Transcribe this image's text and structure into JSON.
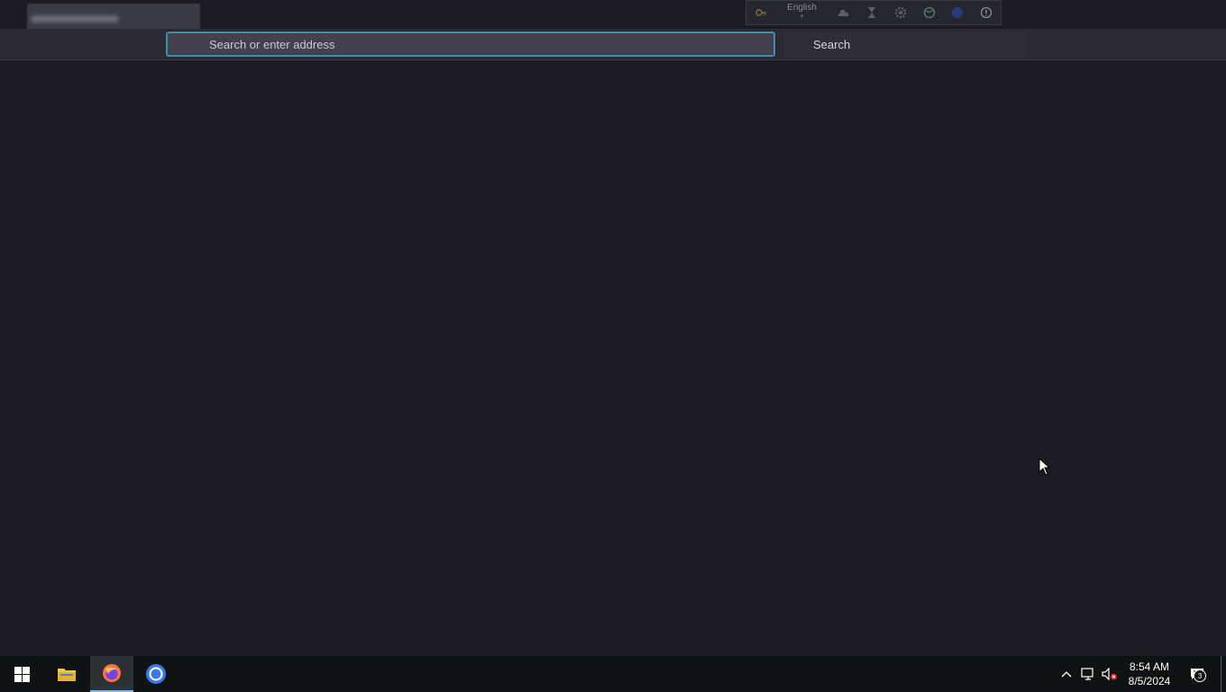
{
  "tab": {
    "title": ""
  },
  "floating_toolbar": {
    "language": "English",
    "icons": [
      "key-icon",
      "language-selector",
      "cloud-icon",
      "hourglass-icon",
      "gear-icon",
      "globe-icon",
      "help-icon",
      "info-icon"
    ]
  },
  "navbar": {
    "url_placeholder": "Search or enter address",
    "url_value": "",
    "search_button_label": "Search"
  },
  "taskbar": {
    "apps": [
      "start-button",
      "file-explorer",
      "firefox",
      "chrome"
    ],
    "active_app": "firefox",
    "tray_icons": [
      "chevron-up-icon",
      "network-icon",
      "volume-muted-icon"
    ],
    "time": "8:54 AM",
    "date": "8/5/2024",
    "notification_count": "3"
  },
  "colors": {
    "page_bg": "#1c1b22",
    "navbar_bg": "#2b2a33",
    "url_focus_border": "#3e8fa5",
    "taskbar_bg": "#101314",
    "taskbar_active_underline": "#76b9ed"
  }
}
